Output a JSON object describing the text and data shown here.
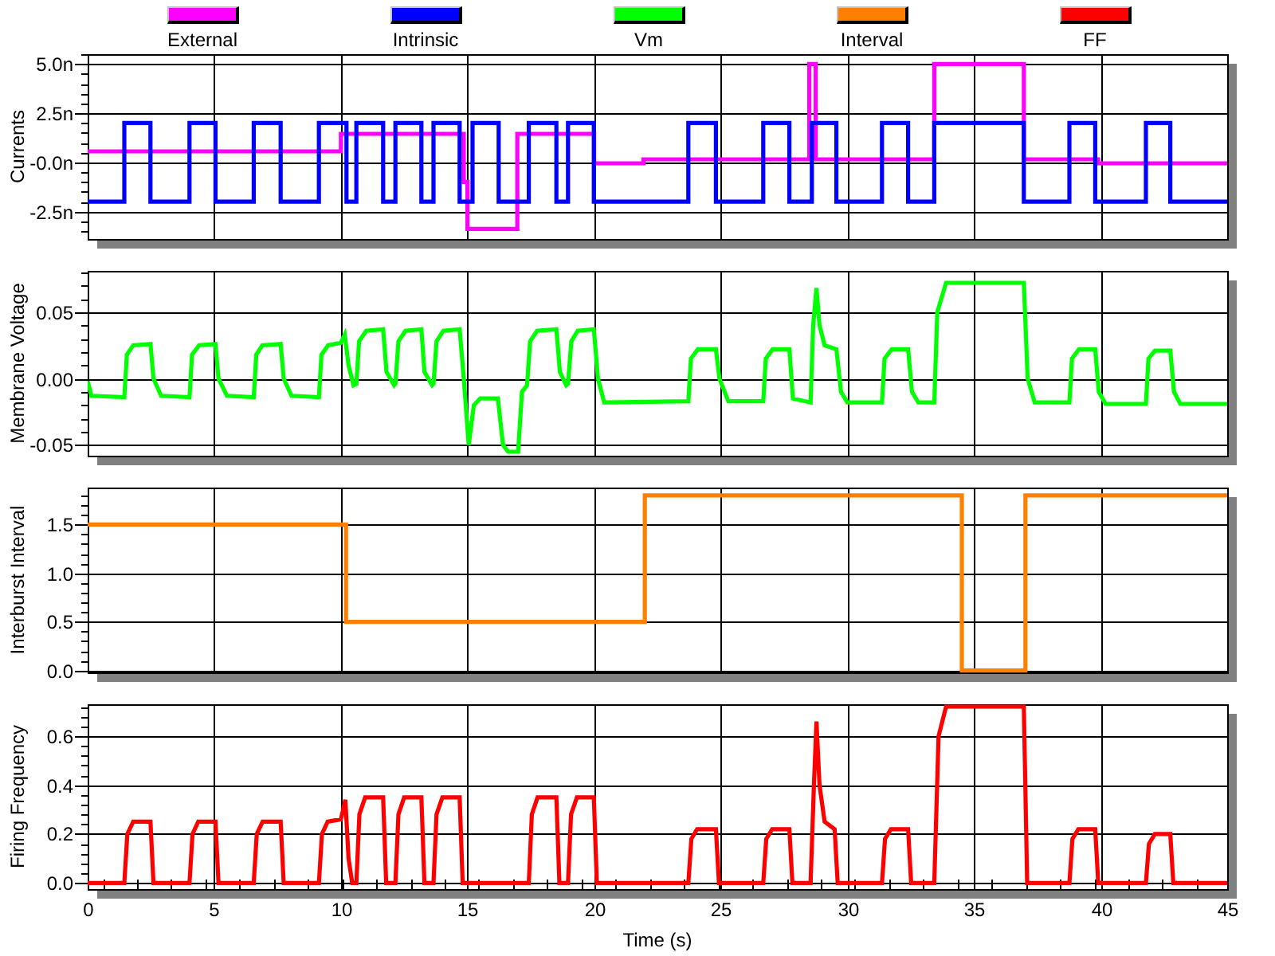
{
  "panels": [
    {
      "chart_data": {
        "type": "line",
        "ylabel": "Currents",
        "xlim": [
          0,
          45
        ],
        "ylim": [
          -3.9,
          5.5
        ],
        "grid": true,
        "yticks": [
          {
            "value": 5,
            "label": "5.0n"
          },
          {
            "value": 2.5,
            "label": "2.5n"
          },
          {
            "value": 0,
            "label": "-0.0n"
          },
          {
            "value": -2.5,
            "label": "-2.5n"
          }
        ],
        "series": [
          {
            "name": "External",
            "color": "#ff00ff",
            "x": [
              0,
              10,
              10,
              14.85,
              14.85,
              15,
              15,
              16.97,
              16.97,
              20,
              20,
              21.95,
              21.95,
              28.5,
              28.5,
              28.75,
              28.75,
              33.43,
              33.43,
              36.97,
              36.97,
              39.9,
              39.9,
              45
            ],
            "values": [
              0.56,
              0.56,
              1.45,
              1.45,
              -1,
              -1,
              -3.39,
              -3.39,
              1.45,
              1.45,
              -0.05,
              -0.05,
              0.15,
              0.15,
              5,
              5,
              0.15,
              0.15,
              5,
              5,
              0.15,
              0.15,
              -0.05,
              -0.05
            ]
          },
          {
            "name": "Intrinsic",
            "color": "#0000ff",
            "x": [
              0,
              1.45,
              1.45,
              2.48,
              2.48,
              4.02,
              4.02,
              5.05,
              5.05,
              6.56,
              6.56,
              7.62,
              7.62,
              9.13,
              9.13,
              10.22,
              10.22,
              10.61,
              10.61,
              11.67,
              11.67,
              12.15,
              12.15,
              13.18,
              13.18,
              13.66,
              13.66,
              14.69,
              14.69,
              15.2,
              15.2,
              16.23,
              16.23,
              17.42,
              17.42,
              18.51,
              18.51,
              18.97,
              18.97,
              19.99,
              19.99,
              23.72,
              23.72,
              24.81,
              24.81,
              26.68,
              26.68,
              27.71,
              27.71,
              28.6,
              28.6,
              29.57,
              29.57,
              31.37,
              31.37,
              32.4,
              32.4,
              33.43,
              33.43,
              36.97,
              36.97,
              38.77,
              38.77,
              39.79,
              39.79,
              41.79,
              41.79,
              42.75,
              42.75,
              45
            ],
            "values": [
              -2,
              -2,
              2,
              2,
              -2,
              -2,
              2,
              2,
              -2,
              -2,
              2,
              2,
              -2,
              -2,
              2,
              2,
              -2,
              -2,
              2,
              2,
              -2,
              -2,
              2,
              2,
              -2,
              -2,
              2,
              2,
              -2,
              -2,
              2,
              2,
              -2,
              -2,
              2,
              2,
              -2,
              -2,
              2,
              2,
              -2,
              -2,
              2,
              2,
              -2,
              -2,
              2,
              2,
              -2,
              -2,
              2,
              2,
              -2,
              -2,
              2,
              2,
              -2,
              -2,
              2,
              2,
              -2,
              -2,
              2,
              2,
              -2,
              -2,
              2,
              2,
              -2,
              -2
            ]
          }
        ]
      }
    },
    {
      "chart_data": {
        "type": "line",
        "ylabel": "Membrane Voltage",
        "xlim": [
          0,
          45
        ],
        "ylim": [
          -0.058,
          0.081
        ],
        "grid": true,
        "yticks": [
          {
            "value": 0.05,
            "label": "0.05"
          },
          {
            "value": 0,
            "label": "0.00"
          },
          {
            "value": -0.05,
            "label": "-0.05"
          }
        ],
        "series": [
          {
            "name": "Vm",
            "color": "#00ff00",
            "x": [
              0,
              0.15,
              1.45,
              1.55,
              1.8,
              2.48,
              2.6,
              2.9,
              4.02,
              4.12,
              4.4,
              5.05,
              5.17,
              5.5,
              6.56,
              6.66,
              6.9,
              7.62,
              7.74,
              8.05,
              9.13,
              9.23,
              9.5,
              10.0,
              10.15,
              10.3,
              10.5,
              10.61,
              10.72,
              11.0,
              11.67,
              11.8,
              12.1,
              12.15,
              12.27,
              12.55,
              13.18,
              13.3,
              13.6,
              13.66,
              13.78,
              14.05,
              14.69,
              14.85,
              15.05,
              15.25,
              15.5,
              16.2,
              16.4,
              16.6,
              17.0,
              17.15,
              17.35,
              17.47,
              17.75,
              18.51,
              18.65,
              18.9,
              18.97,
              19.1,
              19.35,
              19.99,
              20.15,
              20.4,
              23.72,
              23.82,
              24.1,
              24.81,
              24.95,
              25.3,
              26.68,
              26.78,
              27.05,
              27.71,
              27.85,
              28.55,
              28.65,
              28.78,
              28.9,
              29.1,
              29.57,
              29.75,
              30.0,
              31.37,
              31.47,
              31.75,
              32.4,
              32.55,
              32.8,
              33.43,
              33.55,
              33.9,
              36.97,
              37.12,
              37.4,
              38.77,
              38.87,
              39.15,
              39.79,
              39.93,
              40.2,
              41.79,
              41.89,
              42.15,
              42.75,
              42.9,
              43.15,
              45
            ],
            "values": [
              -0.002,
              -0.013,
              -0.014,
              0.018,
              0.025,
              0.026,
              0.0,
              -0.013,
              -0.014,
              0.018,
              0.025,
              0.026,
              0.0,
              -0.013,
              -0.014,
              0.018,
              0.025,
              0.026,
              0.0,
              -0.013,
              -0.014,
              0.018,
              0.025,
              0.027,
              0.033,
              0.01,
              -0.005,
              -0.004,
              0.028,
              0.036,
              0.037,
              0.005,
              -0.005,
              -0.004,
              0.028,
              0.036,
              0.037,
              0.005,
              -0.005,
              -0.004,
              0.028,
              0.036,
              0.037,
              0.0,
              -0.05,
              -0.02,
              -0.015,
              -0.015,
              -0.05,
              -0.055,
              -0.055,
              -0.01,
              -0.005,
              0.028,
              0.036,
              0.037,
              0.005,
              -0.005,
              -0.004,
              0.028,
              0.036,
              0.037,
              0.0,
              -0.018,
              -0.017,
              0.015,
              0.022,
              0.022,
              0.0,
              -0.017,
              -0.017,
              0.015,
              0.022,
              0.022,
              -0.015,
              -0.018,
              0.04,
              0.068,
              0.04,
              0.025,
              0.022,
              -0.01,
              -0.018,
              -0.018,
              0.015,
              0.022,
              0.022,
              -0.01,
              -0.018,
              -0.018,
              0.05,
              0.072,
              0.072,
              0.0,
              -0.018,
              -0.018,
              0.015,
              0.022,
              0.022,
              -0.01,
              -0.019,
              -0.019,
              0.015,
              0.021,
              0.021,
              -0.01,
              -0.019,
              -0.019
            ]
          }
        ]
      }
    },
    {
      "chart_data": {
        "type": "line",
        "ylabel": "Interburst Interval",
        "xlim": [
          0,
          45
        ],
        "ylim": [
          -0.02,
          1.88
        ],
        "grid": true,
        "yticks": [
          {
            "value": 1.5,
            "label": "1.5"
          },
          {
            "value": 1,
            "label": "1.0"
          },
          {
            "value": 0.5,
            "label": "0.5"
          },
          {
            "value": 0,
            "label": "0.0"
          }
        ],
        "series": [
          {
            "name": "Interval",
            "color": "#ff8000",
            "x": [
              0,
              10.2,
              10.2,
              22,
              22,
              34.52,
              34.52,
              37.03,
              37.03,
              45
            ],
            "values": [
              1.5,
              1.5,
              0.5,
              0.5,
              1.8,
              1.8,
              0,
              0,
              1.8,
              1.8
            ]
          }
        ]
      }
    },
    {
      "chart_data": {
        "type": "line",
        "ylabel": "Firing Frequency",
        "xlabel": "Time (s)",
        "xlim": [
          0,
          45
        ],
        "ylim": [
          -0.025,
          0.73
        ],
        "grid": true,
        "xticks": [
          0,
          5,
          10,
          15,
          20,
          25,
          30,
          35,
          40,
          45
        ],
        "yticks": [
          {
            "value": 0.6,
            "label": "0.6"
          },
          {
            "value": 0.4,
            "label": "0.4"
          },
          {
            "value": 0.2,
            "label": "0.2"
          },
          {
            "value": 0,
            "label": "0.0"
          }
        ],
        "series": [
          {
            "name": "FF",
            "color": "#ff0000",
            "x": [
              0,
              1.45,
              1.57,
              1.8,
              2.48,
              2.6,
              4.02,
              4.14,
              4.37,
              5.05,
              5.17,
              6.56,
              6.68,
              6.91,
              7.62,
              7.74,
              9.13,
              9.25,
              9.48,
              10.0,
              10.18,
              10.3,
              10.45,
              10.61,
              10.73,
              10.96,
              11.67,
              11.79,
              12.15,
              12.27,
              12.5,
              13.18,
              13.3,
              13.66,
              13.78,
              14.01,
              14.69,
              14.81,
              17.42,
              17.54,
              17.77,
              18.51,
              18.63,
              18.97,
              19.09,
              19.32,
              19.99,
              20.11,
              23.72,
              23.84,
              24.07,
              24.81,
              24.93,
              26.68,
              26.8,
              27.03,
              27.71,
              27.83,
              28.55,
              28.68,
              28.78,
              28.9,
              29.1,
              29.5,
              29.62,
              31.37,
              31.49,
              31.72,
              32.4,
              32.52,
              33.43,
              33.6,
              33.9,
              36.97,
              37.1,
              38.77,
              38.89,
              39.12,
              39.79,
              39.91,
              41.79,
              41.91,
              42.14,
              42.75,
              42.87,
              45
            ],
            "values": [
              0,
              0,
              0.2,
              0.25,
              0.25,
              0,
              0,
              0.2,
              0.25,
              0.25,
              0,
              0,
              0.2,
              0.25,
              0.25,
              0,
              0,
              0.2,
              0.25,
              0.26,
              0.34,
              0.1,
              0,
              0,
              0.28,
              0.35,
              0.35,
              0,
              0,
              0.28,
              0.35,
              0.35,
              0,
              0,
              0.28,
              0.35,
              0.35,
              0,
              0,
              0.28,
              0.35,
              0.35,
              0,
              0,
              0.28,
              0.35,
              0.35,
              0,
              0,
              0.18,
              0.22,
              0.22,
              0,
              0,
              0.18,
              0.22,
              0.22,
              0,
              0,
              0.4,
              0.66,
              0.4,
              0.25,
              0.22,
              0,
              0,
              0.18,
              0.22,
              0.22,
              0,
              0,
              0.6,
              0.72,
              0.72,
              0,
              0,
              0.18,
              0.22,
              0.22,
              0,
              0,
              0.16,
              0.2,
              0.2,
              0,
              0
            ]
          }
        ]
      }
    }
  ]
}
